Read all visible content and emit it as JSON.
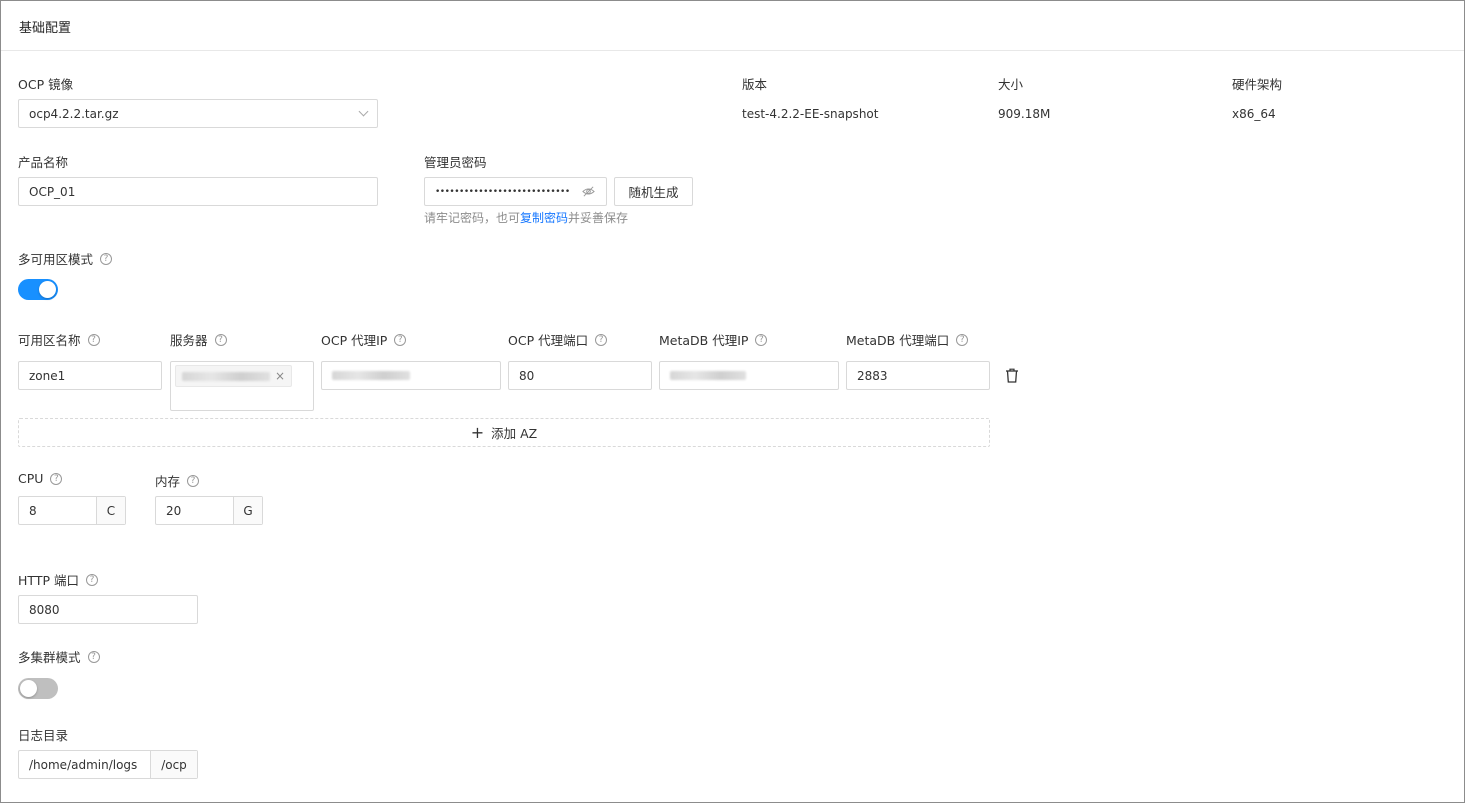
{
  "header": {
    "title": "基础配置"
  },
  "image": {
    "label": "OCP 镜像",
    "value": "ocp4.2.2.tar.gz"
  },
  "info": [
    {
      "label": "版本",
      "value": "test-4.2.2-EE-snapshot"
    },
    {
      "label": "大小",
      "value": "909.18M"
    },
    {
      "label": "硬件架构",
      "value": "x86_64"
    }
  ],
  "product": {
    "label": "产品名称",
    "value": "OCP_01"
  },
  "password": {
    "label": "管理员密码",
    "masked": "••••••••••••••••••••••••••••",
    "generate_label": "随机生成",
    "hint_before": "请牢记密码，也可",
    "hint_link": "复制密码",
    "hint_after": "并妥善保存"
  },
  "multi_az": {
    "label": "多可用区模式",
    "enabled": true
  },
  "az_table": {
    "columns": [
      "可用区名称",
      "服务器",
      "OCP 代理IP",
      "OCP 代理端口",
      "MetaDB 代理IP",
      "MetaDB 代理端口"
    ],
    "rows": [
      {
        "zone": "zone1",
        "ocp_port": "80",
        "metadb_port": "2883"
      }
    ],
    "add_label": "添加 AZ",
    "add_icon": "+"
  },
  "cpu": {
    "label": "CPU",
    "value": "8",
    "unit": "C"
  },
  "memory": {
    "label": "内存",
    "value": "20",
    "unit": "G"
  },
  "http_port": {
    "label": "HTTP 端口",
    "value": "8080"
  },
  "multi_cluster": {
    "label": "多集群模式",
    "enabled": false
  },
  "log_dir": {
    "label": "日志目录",
    "value": "/home/admin/logs",
    "suffix": "/ocp"
  },
  "icons": {
    "help": "?",
    "remove_tag": "×"
  }
}
